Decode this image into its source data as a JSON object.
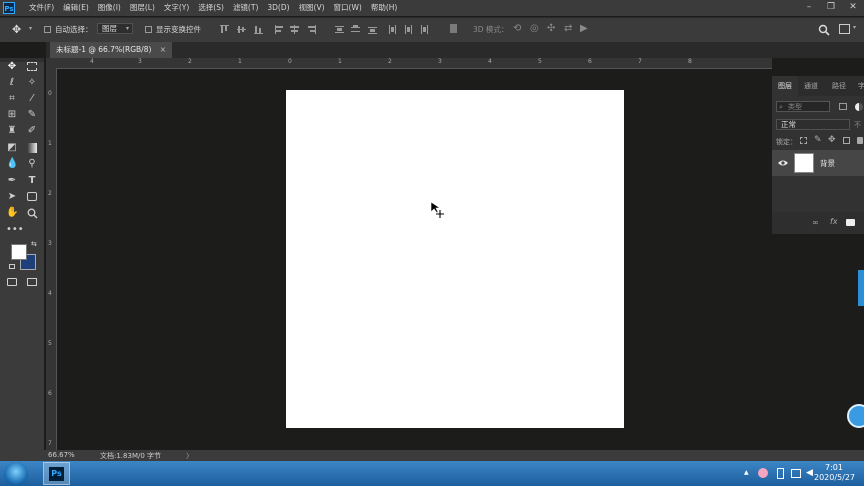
{
  "app": {
    "logo": "Ps"
  },
  "menubar": {
    "items": [
      "文件(F)",
      "编辑(E)",
      "图像(I)",
      "图层(L)",
      "文字(Y)",
      "选择(S)",
      "滤镜(T)",
      "3D(D)",
      "视图(V)",
      "窗口(W)",
      "帮助(H)"
    ]
  },
  "options": {
    "auto_select_label": "自动选择：",
    "auto_select_value": "图层",
    "show_transform_label": "显示变换控件",
    "mode_3d_label": "3D 模式："
  },
  "document": {
    "tab_title": "未标题-1 @ 66.7%(RGB/8)",
    "close": "×"
  },
  "rulers": {
    "top": [
      "4",
      "3",
      "2",
      "1",
      "0",
      "1",
      "2",
      "3",
      "4",
      "5",
      "6",
      "7",
      "8"
    ],
    "left": [
      "0",
      "1",
      "2",
      "3",
      "4",
      "5",
      "6",
      "7"
    ]
  },
  "layers_panel": {
    "tabs": [
      "图层",
      "通道",
      "路径",
      "字"
    ],
    "search_placeholder": "类型",
    "blend_mode": "正常",
    "opacity_label": "不",
    "lock_label": "锁定：",
    "layer_name": "背景"
  },
  "statusbar": {
    "zoom": "66.67%",
    "doc_info": "文档:1.83M/0 字节",
    "arrow": "〉"
  },
  "taskbar": {
    "time": "7:01",
    "date": "2020/5/27",
    "tray_arrow": "▲",
    "ps_label": "Ps"
  },
  "colors": {
    "accent": "#31a8ff",
    "foreground": "#ffffff",
    "background_swatch": "#1f3f7a"
  }
}
